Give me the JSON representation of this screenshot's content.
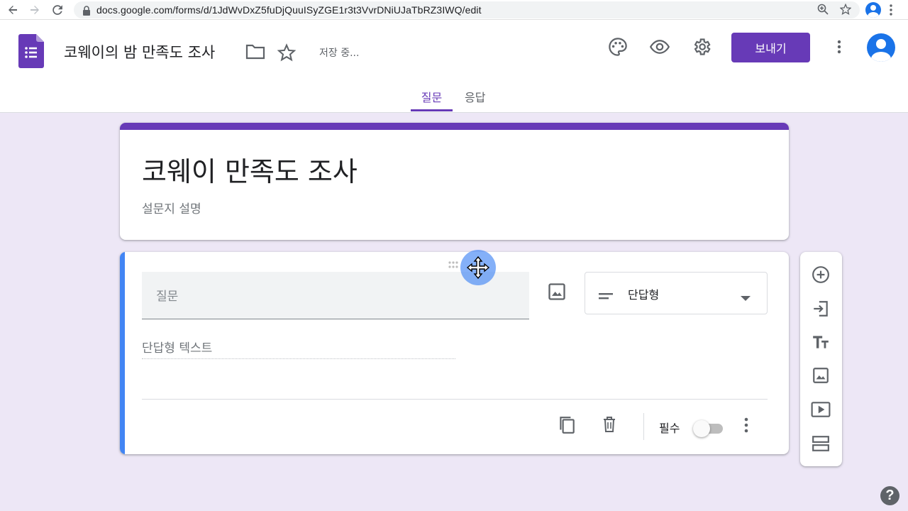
{
  "browser": {
    "url": "docs.google.com/forms/d/1JdWvDxZ5fuDjQuuISyZGE1r3t3VvrDNiUJaTbRZ3IWQ/edit",
    "icons": [
      "back-arrow-icon",
      "forward-arrow-icon",
      "reload-icon",
      "lock-icon",
      "zoom-icon",
      "bookmark-star-icon",
      "profile-icon",
      "browser-menu-icon"
    ]
  },
  "header": {
    "doc_title": "코웨이의 밤 만족도 조사",
    "saving_status": "저장 중...",
    "send_label": "보내기",
    "accent_color": "#673ab7"
  },
  "tabs": [
    {
      "label": "질문",
      "active": true
    },
    {
      "label": "응답",
      "active": false
    }
  ],
  "form": {
    "title": "코웨이 만족도 조사",
    "description": "설문지 설명"
  },
  "question": {
    "placeholder": "질문",
    "type_label": "단답형",
    "answer_placeholder": "단답형 텍스트",
    "required_label": "필수",
    "required_on": false
  },
  "side_tools": [
    "add-question-icon",
    "import-questions-icon",
    "add-title-icon",
    "add-image-icon",
    "add-video-icon",
    "add-section-icon"
  ],
  "help": "?"
}
